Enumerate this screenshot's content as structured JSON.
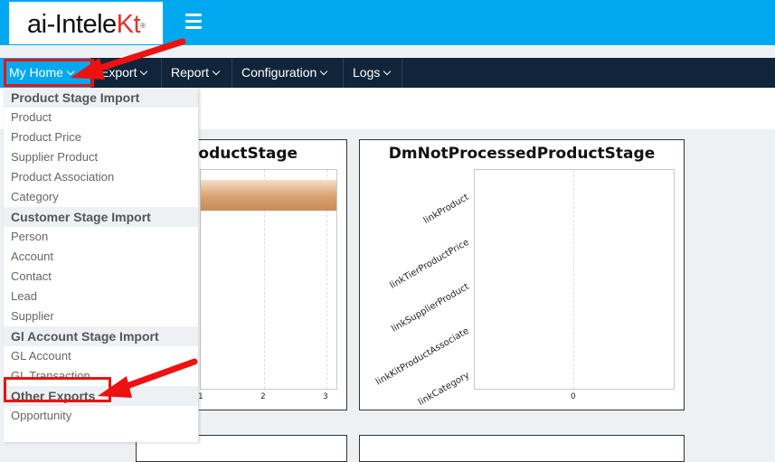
{
  "app": {
    "logo_text_main": "ai-Intele",
    "logo_text_accent": "Kt",
    "logo_mark": "®",
    "menu_icon": "hamburger-icon"
  },
  "nav": {
    "items": [
      {
        "label": "My Home"
      },
      {
        "label": "Export"
      },
      {
        "label": "Report"
      },
      {
        "label": "Configuration"
      },
      {
        "label": "Logs"
      }
    ]
  },
  "dropdown": {
    "groups": [
      {
        "header": "Product Stage Import",
        "items": [
          "Product",
          "Product Price",
          "Supplier Product",
          "Product Association",
          "Category"
        ]
      },
      {
        "header": "Customer Stage Import",
        "items": [
          "Person",
          "Account",
          "Contact",
          "Lead",
          "Supplier"
        ]
      },
      {
        "header": "Gl Account Stage Import",
        "items": [
          "GL Account",
          "GL Transaction"
        ]
      },
      {
        "header": "Other Exports",
        "items": [
          "Opportunity"
        ]
      }
    ]
  },
  "charts": {
    "left": {
      "title": "roductStage",
      "x_ticks": [
        "1",
        "2",
        "3"
      ]
    },
    "right": {
      "title": "DmNotProcessedProductStage",
      "y_labels": [
        "linkProduct",
        "linkTierProductPrice",
        "linkSupplierProduct",
        "linkKitProductAssociate",
        "linkCategory"
      ],
      "x_ticks": [
        "0"
      ]
    }
  },
  "chart_data": [
    {
      "type": "bar",
      "title": "roductStage",
      "orientation": "horizontal",
      "values": [
        3
      ],
      "xlim": [
        0.5,
        3
      ],
      "x_ticks": [
        "1",
        "2",
        "3"
      ]
    },
    {
      "type": "bar",
      "title": "DmNotProcessedProductStage",
      "orientation": "horizontal",
      "categories": [
        "linkProduct",
        "linkTierProductPrice",
        "linkSupplierProduct",
        "linkKitProductAssociate",
        "linkCategory"
      ],
      "values": [
        0,
        0,
        0,
        0,
        0
      ],
      "x_ticks": [
        "0"
      ]
    }
  ],
  "colors": {
    "topbar": "#00a9ef",
    "navbar": "#11253a",
    "logo_accent": "#e4312b",
    "annotation": "#e11111",
    "bar": "#d8a06f"
  }
}
